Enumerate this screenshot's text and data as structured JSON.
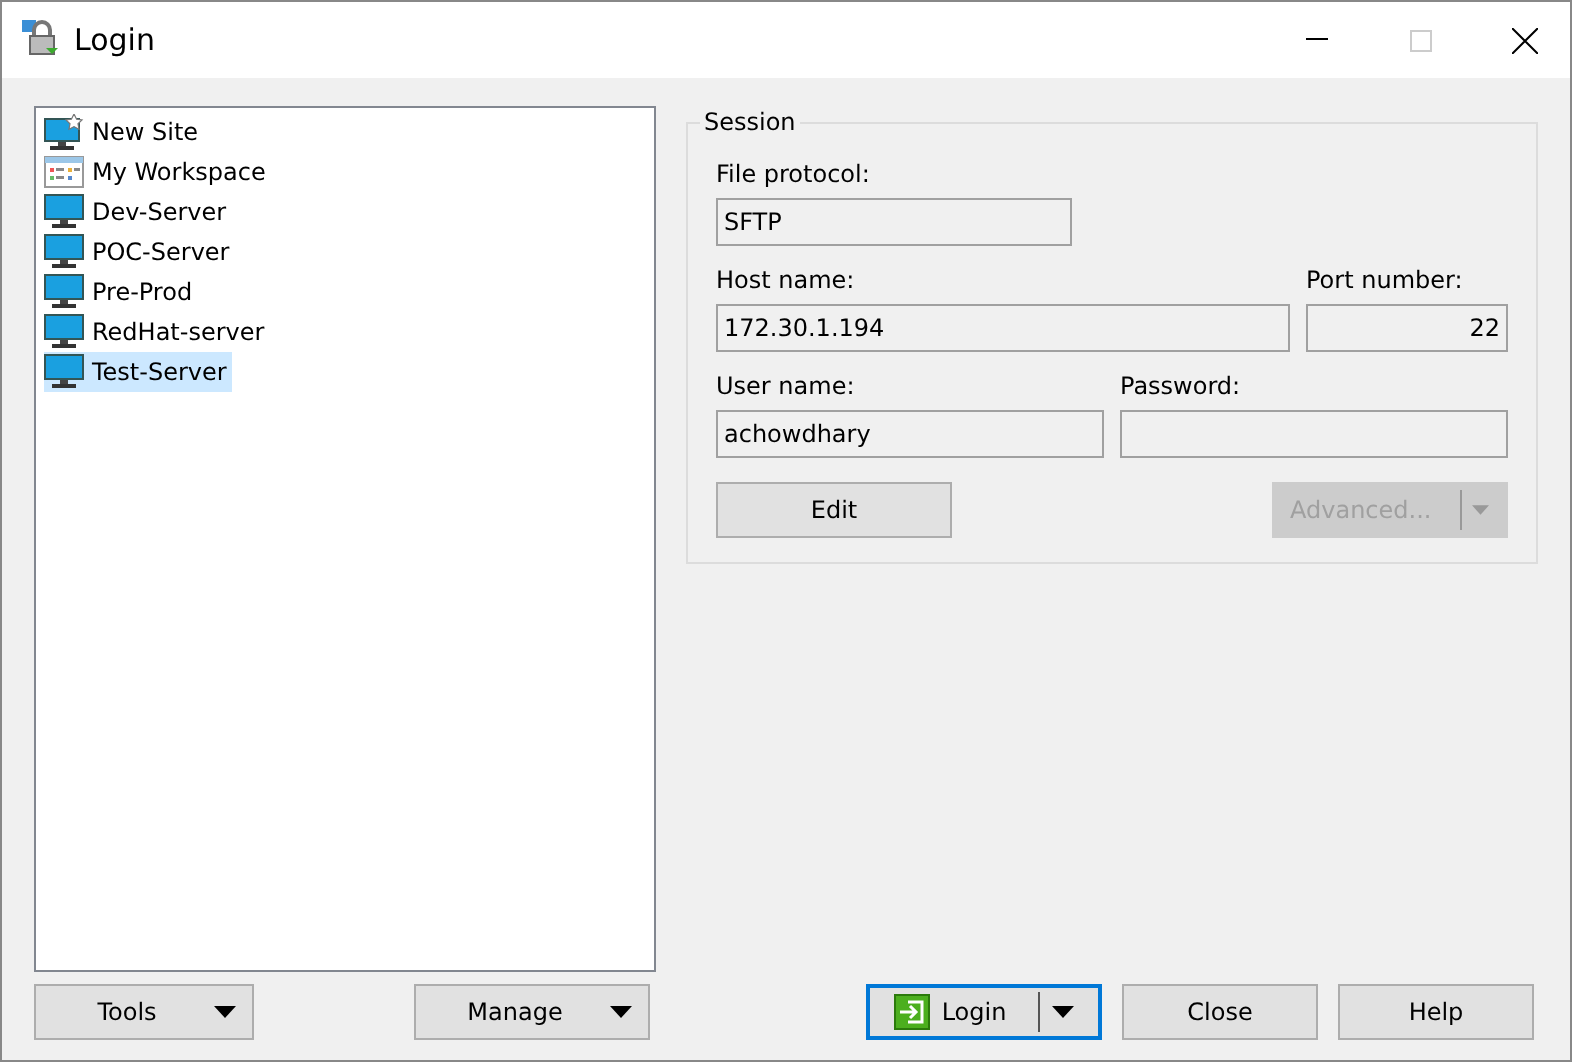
{
  "window": {
    "title": "Login"
  },
  "sites": [
    {
      "kind": "new_site",
      "label": "New Site",
      "selected": false
    },
    {
      "kind": "workspace",
      "label": "My Workspace",
      "selected": false
    },
    {
      "kind": "site",
      "label": "Dev-Server",
      "selected": false
    },
    {
      "kind": "site",
      "label": "POC-Server",
      "selected": false
    },
    {
      "kind": "site",
      "label": "Pre-Prod",
      "selected": false
    },
    {
      "kind": "site",
      "label": "RedHat-server",
      "selected": false
    },
    {
      "kind": "site",
      "label": "Test-Server",
      "selected": true
    }
  ],
  "session": {
    "title": "Session",
    "file_protocol": {
      "label": "File protocol:",
      "value": "SFTP"
    },
    "host_name": {
      "label": "Host name:",
      "value": "172.30.1.194"
    },
    "port_number": {
      "label": "Port number:",
      "value": "22"
    },
    "user_name": {
      "label": "User name:",
      "value": "achowdhary"
    },
    "password": {
      "label": "Password:"
    },
    "edit_button": {
      "label": "Edit",
      "disabled": false
    },
    "advanced_button": {
      "label": "Advanced...",
      "disabled": true
    }
  },
  "bottom_buttons": [
    {
      "kind": "menu",
      "label": "Tools",
      "default": false
    },
    {
      "kind": "menu",
      "label": "Manage",
      "default": false
    },
    {
      "kind": "split",
      "label": "Login",
      "default": true
    },
    {
      "kind": "plain",
      "label": "Close",
      "default": false
    },
    {
      "kind": "plain",
      "label": "Help",
      "default": false
    }
  ]
}
